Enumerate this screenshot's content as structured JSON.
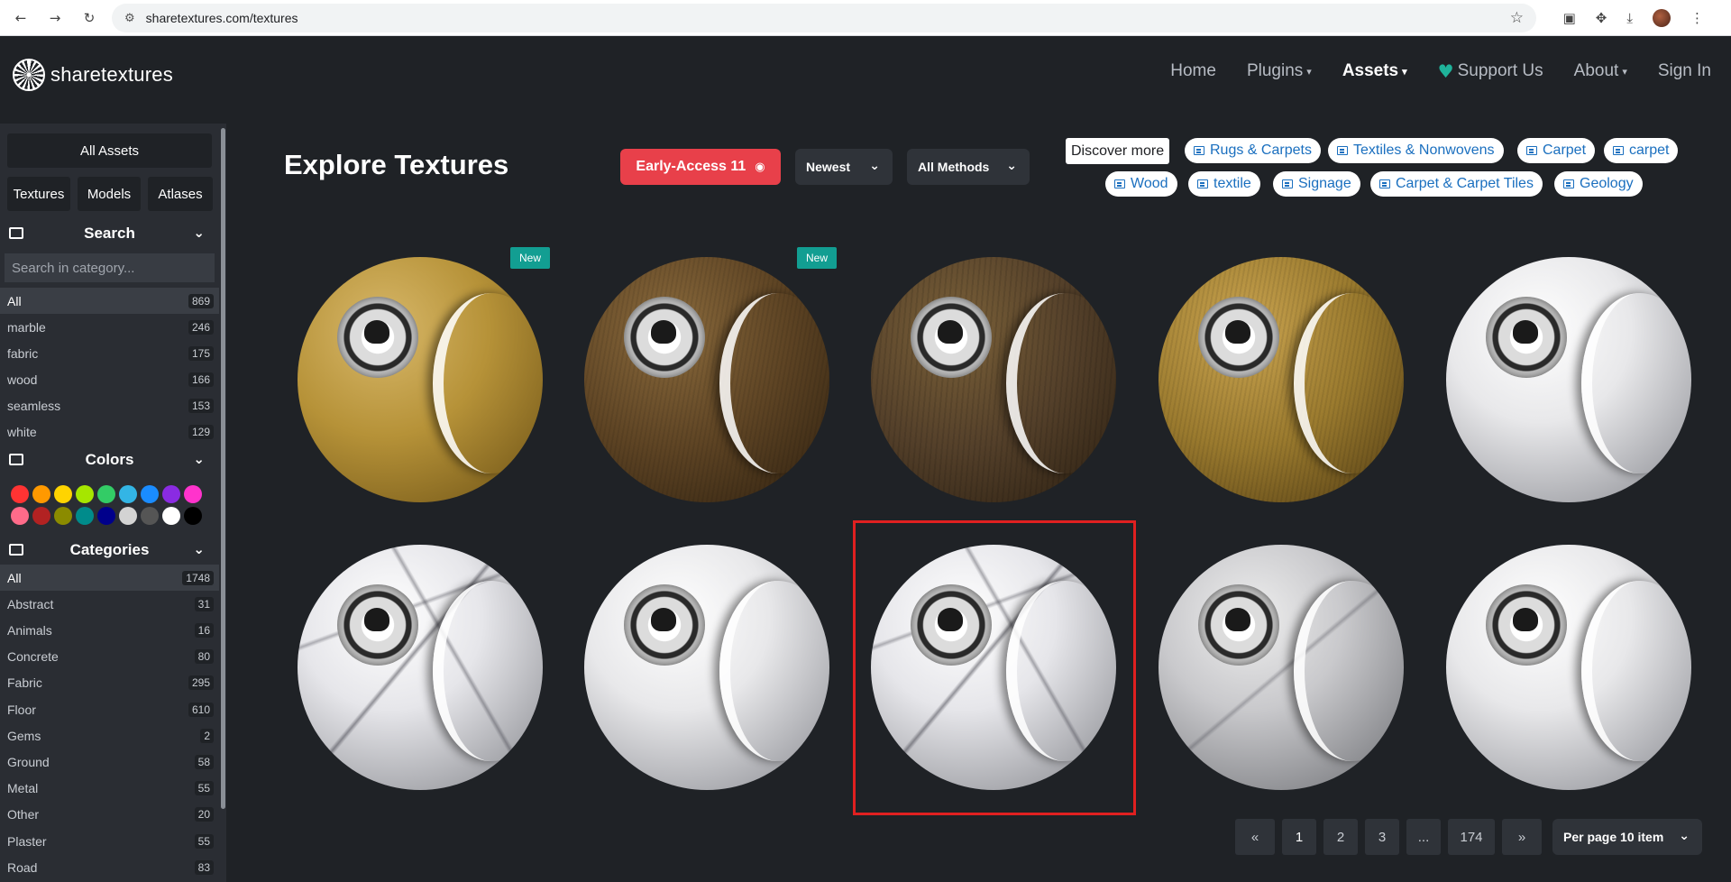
{
  "browser": {
    "url": "sharetextures.com/textures",
    "back_icon": "arrow-left-icon",
    "forward_icon": "arrow-right-icon",
    "reload_icon": "reload-icon"
  },
  "header": {
    "logo_text": "sharetextures",
    "nav": [
      {
        "label": "Home"
      },
      {
        "label": "Plugins"
      },
      {
        "label": "Assets"
      },
      {
        "label": "Support Us"
      },
      {
        "label": "About"
      },
      {
        "label": "Sign In"
      }
    ]
  },
  "sidebar": {
    "all_assets": "All Assets",
    "type_buttons": [
      "Textures",
      "Models",
      "Atlases"
    ],
    "search_title": "Search",
    "search_placeholder": "Search in category...",
    "tags": [
      {
        "label": "All",
        "count": "869"
      },
      {
        "label": "marble",
        "count": "246"
      },
      {
        "label": "fabric",
        "count": "175"
      },
      {
        "label": "wood",
        "count": "166"
      },
      {
        "label": "seamless",
        "count": "153"
      },
      {
        "label": "white",
        "count": "129"
      }
    ],
    "colors_title": "Colors",
    "colors": [
      "#ff3333",
      "#ff9900",
      "#ffd400",
      "#a6e600",
      "#33cc66",
      "#33b5e5",
      "#1a8cff",
      "#8a2be2",
      "#ff33cc",
      "#ff6b8a",
      "#b22222",
      "#8b8b00",
      "#008b8b",
      "#00008b",
      "#d3d3d3",
      "#555555",
      "#ffffff",
      "#000000"
    ],
    "categories_title": "Categories",
    "categories": [
      {
        "label": "All",
        "count": "1748"
      },
      {
        "label": "Abstract",
        "count": "31"
      },
      {
        "label": "Animals",
        "count": "16"
      },
      {
        "label": "Concrete",
        "count": "80"
      },
      {
        "label": "Fabric",
        "count": "295"
      },
      {
        "label": "Floor",
        "count": "610"
      },
      {
        "label": "Gems",
        "count": "2"
      },
      {
        "label": "Ground",
        "count": "58"
      },
      {
        "label": "Metal",
        "count": "55"
      },
      {
        "label": "Other",
        "count": "20"
      },
      {
        "label": "Plaster",
        "count": "55"
      },
      {
        "label": "Road",
        "count": "83"
      }
    ]
  },
  "main": {
    "title": "Explore Textures",
    "early_access": "Early-Access 11",
    "sort": "Newest",
    "methods": "All Methods",
    "discover": "Discover more",
    "tags": [
      "Rugs & Carpets",
      "Textiles & Nonwovens",
      "Carpet",
      "carpet",
      "Wood",
      "textile",
      "Signage",
      "Carpet & Carpet Tiles",
      "Geology"
    ],
    "new_badge": "New"
  },
  "pagination": {
    "prev": "«",
    "pages": [
      "1",
      "2",
      "3",
      "...",
      "174"
    ],
    "next": "»",
    "per_page": "Per page 10 item"
  }
}
